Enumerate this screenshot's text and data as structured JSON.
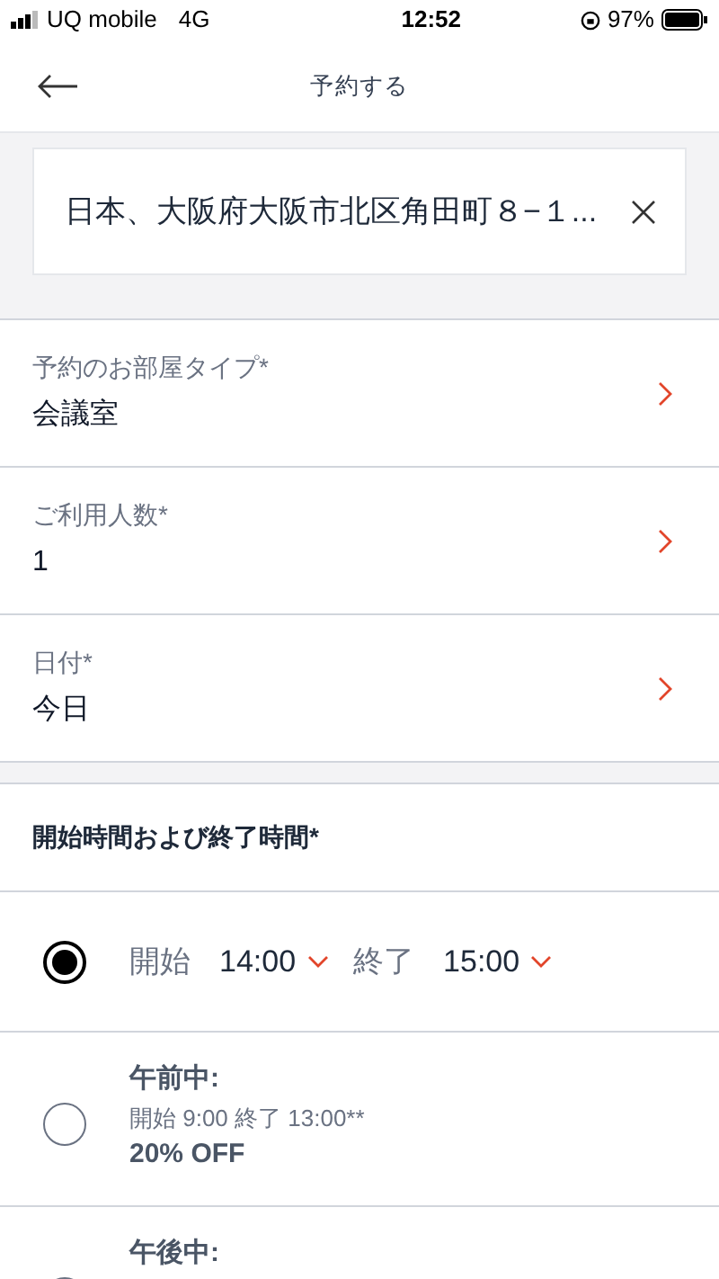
{
  "status_bar": {
    "carrier": "UQ mobile",
    "network": "4G",
    "time": "12:52",
    "battery": "97%"
  },
  "header": {
    "title": "予約する"
  },
  "location": {
    "value": "日本、大阪府大阪市北区角田町８−１..."
  },
  "fields": [
    {
      "label": "予約のお部屋タイプ*",
      "value": "会議室"
    },
    {
      "label": "ご利用人数*",
      "value": "1"
    },
    {
      "label": "日付*",
      "value": "今日"
    }
  ],
  "time_section": {
    "heading": "開始時間および終了時間*"
  },
  "time_options": [
    {
      "kind": "custom",
      "selected": true,
      "start_label": "開始",
      "start": "14:00",
      "end_label": "終了",
      "end": "15:00"
    },
    {
      "kind": "preset",
      "selected": false,
      "title": "午前中:",
      "detail": "開始 9:00 終了 13:00**",
      "discount": "20% OFF"
    },
    {
      "kind": "preset",
      "selected": false,
      "title": "午後中:"
    }
  ]
}
